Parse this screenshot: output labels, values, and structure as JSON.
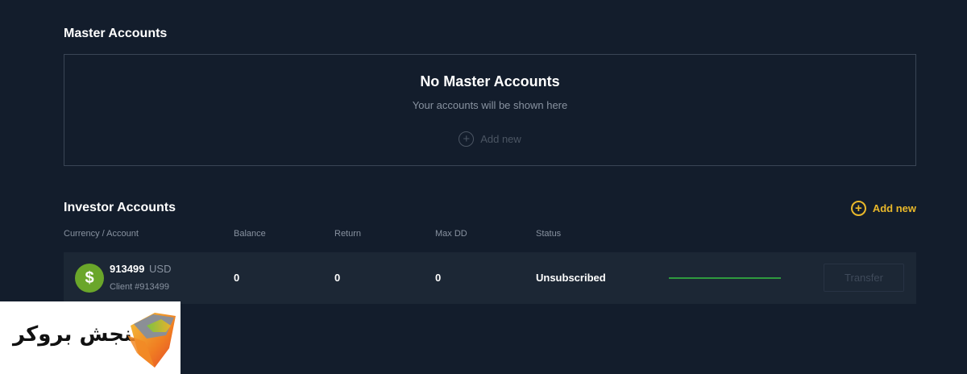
{
  "master": {
    "title": "Master Accounts",
    "empty_heading": "No Master Accounts",
    "empty_subtext": "Your accounts will be shown here",
    "add_new_label": "Add new",
    "add_icon": "plus-circle-icon"
  },
  "investor": {
    "title": "Investor Accounts",
    "add_new_label": "Add new",
    "add_icon": "plus-circle-icon",
    "columns": [
      "Currency / Account",
      "Balance",
      "Return",
      "Max DD",
      "Status"
    ],
    "rows": [
      {
        "icon": "dollar-icon",
        "icon_glyph": "$",
        "account": "913499",
        "currency": "USD",
        "client": "Client #913499",
        "balance": "0",
        "return": "0",
        "max_dd": "0",
        "status": "Unsubscribed",
        "progress": 1.0,
        "action_label": "Transfer"
      }
    ]
  },
  "logo": {
    "text": "سنجش بروکر"
  },
  "colors": {
    "background": "#131d2c",
    "row_background": "#1c2735",
    "accent": "#e9b82a",
    "currency_icon": "#6aa62a",
    "progress": "#2e9a3e"
  }
}
